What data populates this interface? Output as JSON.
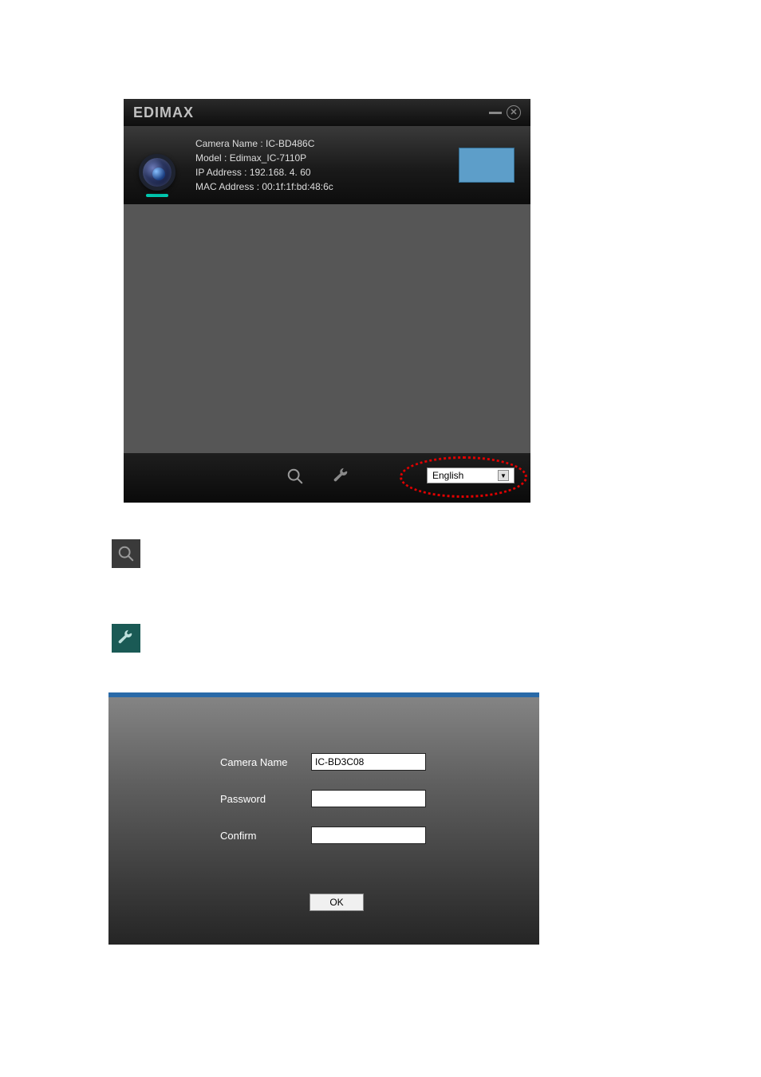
{
  "window1": {
    "logo": "EDIMAX",
    "camera": {
      "name_label": "Camera Name : ",
      "name_value": "IC-BD486C",
      "model_label": "Model : ",
      "model_value": "Edimax_IC-7110P",
      "ip_label": "IP Address : ",
      "ip_value": "192.168.  4. 60",
      "mac_label": "MAC Address : ",
      "mac_value": "00:1f:1f:bd:48:6c"
    },
    "language": "English"
  },
  "window2": {
    "camera_name_label": "Camera Name",
    "camera_name_value": "IC-BD3C08",
    "password_label": "Password",
    "confirm_label": "Confirm",
    "ok_label": "OK"
  }
}
